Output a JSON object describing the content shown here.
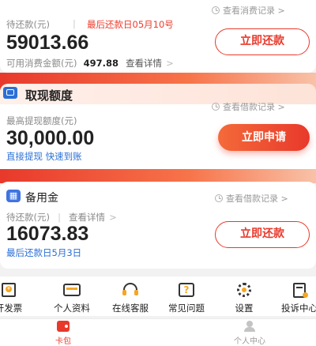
{
  "consumer": {
    "link": "查看消费记录",
    "pending_label": "待还款(元)",
    "separator": "|",
    "due_label": "最后还款日05月10号",
    "amount": "59013.66",
    "available_label": "可用消费金额(元)",
    "available_value": "497.88",
    "detail_link": "查看详情",
    "button": "立即还款"
  },
  "cash": {
    "title": "取现额度",
    "link": "查看借款记录",
    "max_label": "最高提现额度(元)",
    "amount": "30,000.00",
    "tags": "直接提现 快速到账",
    "button": "立即申请"
  },
  "backup": {
    "title": "备用金",
    "link": "查看借款记录",
    "pending_label": "待还款(元)",
    "separator": "|",
    "detail_link": "查看详情",
    "amount": "16073.83",
    "due_label": "最后还款日5月3日",
    "button": "立即还款"
  },
  "menu": [
    {
      "label": "开发票",
      "icon": "invoice-icon"
    },
    {
      "label": "个人资料",
      "icon": "profile-card-icon"
    },
    {
      "label": "在线客服",
      "icon": "headset-icon"
    },
    {
      "label": "常见问题",
      "icon": "question-icon"
    },
    {
      "label": "设置",
      "icon": "gear-icon"
    },
    {
      "label": "投诉中心",
      "icon": "complaint-icon"
    }
  ],
  "tabs": [
    {
      "label": "卡包",
      "icon": "wallet-icon",
      "active": true
    },
    {
      "label": "个人中心",
      "icon": "user-icon",
      "active": false
    }
  ],
  "colors": {
    "accent_red": "#e8392b",
    "link_blue": "#2b6fd6",
    "orange": "#f46a3a"
  }
}
